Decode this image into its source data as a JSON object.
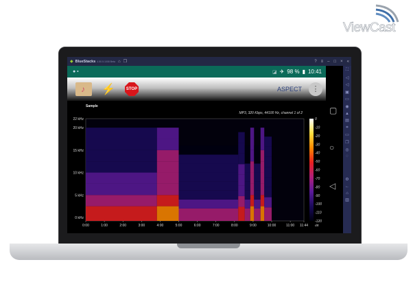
{
  "logo": {
    "text": "ViewCast"
  },
  "bluestacks": {
    "title": "BlueStacks",
    "version": "4.50.5.1008 Beta"
  },
  "status_bar": {
    "battery": "98 %",
    "time": "10:41"
  },
  "toolbar": {
    "aspect_label": "ASPECT",
    "stop_label": "STOP"
  },
  "plot": {
    "title": "Sample",
    "info": "MP3, 320 Kbps, 44100 Hz, channel 1 of 2"
  },
  "chart_data": {
    "type": "heatmap",
    "title": "Sample",
    "subtitle": "MP3, 320 Kbps, 44100 Hz, channel 1 of 2",
    "x_ticks": [
      "0:00",
      "1:00",
      "2:00",
      "3:00",
      "4:00",
      "5:00",
      "6:00",
      "7:00",
      "8:00",
      "9:00",
      "10:00",
      "11:00",
      "11:44"
    ],
    "y_ticks": [
      "22 kHz",
      "20 kHz",
      "15 kHz",
      "10 kHz",
      "5 kHz",
      "0 kHz"
    ],
    "colorbar": {
      "unit": "dB",
      "ticks": [
        "0",
        "-10",
        "-20",
        "-30",
        "-40",
        "-50",
        "-60",
        "-70",
        "-80",
        "-90",
        "-100",
        "-110",
        "-120"
      ],
      "range": [
        -120,
        0
      ],
      "colors": [
        "#000010",
        "#1a0a5a",
        "#5a1a9a",
        "#b0207a",
        "#e82020",
        "#ff8a00",
        "#ffe040",
        "#ffffff"
      ]
    },
    "xlim_min": [
      0,
      11.733
    ],
    "ylim_khz": [
      0,
      22
    ],
    "segments": [
      {
        "start_min": 0,
        "end_min": 3.83,
        "max_khz": 20,
        "level_db": -85
      },
      {
        "start_min": 3.83,
        "end_min": 5.0,
        "max_khz": 20,
        "level_db": -60
      },
      {
        "start_min": 5.0,
        "end_min": 8.2,
        "max_khz": 16,
        "level_db": -92
      },
      {
        "start_min": 8.2,
        "end_min": 8.55,
        "max_khz": 19,
        "level_db": -80
      },
      {
        "start_min": 8.55,
        "end_min": 8.85,
        "max_khz": 16,
        "level_db": -95
      },
      {
        "start_min": 8.85,
        "end_min": 9.05,
        "max_khz": 20,
        "level_db": -65
      },
      {
        "start_min": 9.05,
        "end_min": 9.4,
        "max_khz": 16,
        "level_db": -95
      },
      {
        "start_min": 9.4,
        "end_min": 9.6,
        "max_khz": 20,
        "level_db": -60
      },
      {
        "start_min": 9.6,
        "end_min": 10.0,
        "max_khz": 18,
        "level_db": -90
      }
    ]
  }
}
